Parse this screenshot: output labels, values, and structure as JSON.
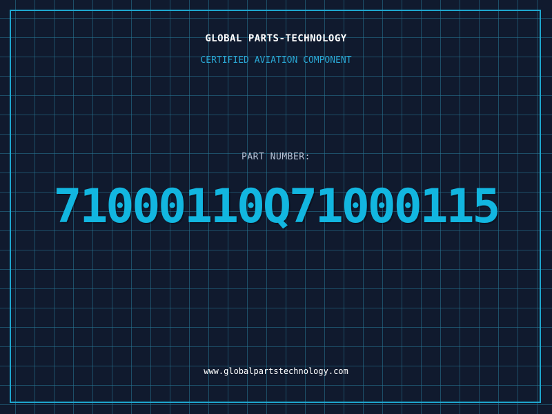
{
  "header": {
    "company": "GLOBAL PARTS-TECHNOLOGY",
    "subtitle": "CERTIFIED AVIATION COMPONENT"
  },
  "part": {
    "label": "PART NUMBER:",
    "number": "71000110Q71000115"
  },
  "footer": {
    "website": "www.globalpartstechnology.com"
  },
  "colors": {
    "background": "#101a2e",
    "grid": "#28788f",
    "border": "#1ea7cf",
    "accent": "#12b6e0",
    "title": "#ffffff"
  }
}
